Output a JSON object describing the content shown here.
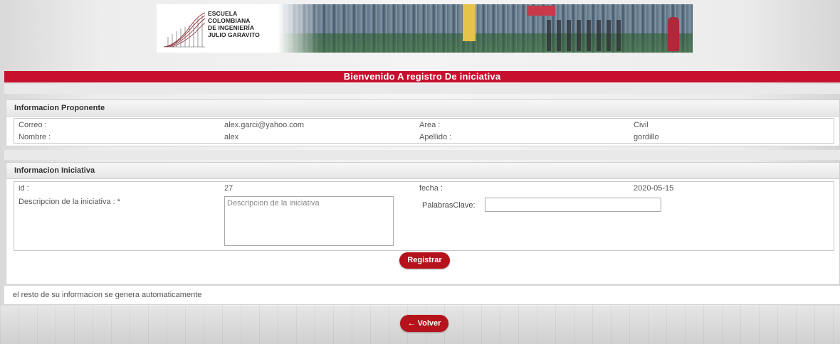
{
  "header": {
    "logo_lines": [
      "ESCUELA",
      "COLOMBIANA",
      "DE INGENIERÍA",
      "JULIO GARAVITO"
    ],
    "title": "Bienvenido A registro De iniciativa"
  },
  "proponente": {
    "section_title": "Informacion Proponente",
    "correo_label": "Correo :",
    "correo_value": "alex.garci@yahoo.com",
    "area_label": "Area :",
    "area_value": "Civil",
    "nombre_label": "Nombre :",
    "nombre_value": "alex",
    "apellido_label": "Apellido :",
    "apellido_value": "gordillo"
  },
  "iniciativa": {
    "section_title": "Informacion Iniciativa",
    "id_label": "id :",
    "id_value": "27",
    "fecha_label": "fecha :",
    "fecha_value": "2020-05-15",
    "descripcion_label": "Descripcion de la iniciativa : *",
    "descripcion_placeholder": "Descripcion de la iniciativa",
    "descripcion_value": "",
    "palabras_label": "PalabrasClave:",
    "palabras_value": "",
    "registrar_label": "Registrar"
  },
  "footer": {
    "note": "el resto de su informacion se genera automaticamente",
    "volver_label": "Volver",
    "volver_icon": "arrow-left-icon"
  },
  "colors": {
    "accent_red": "#c8102e",
    "button_red": "#b5121b"
  }
}
